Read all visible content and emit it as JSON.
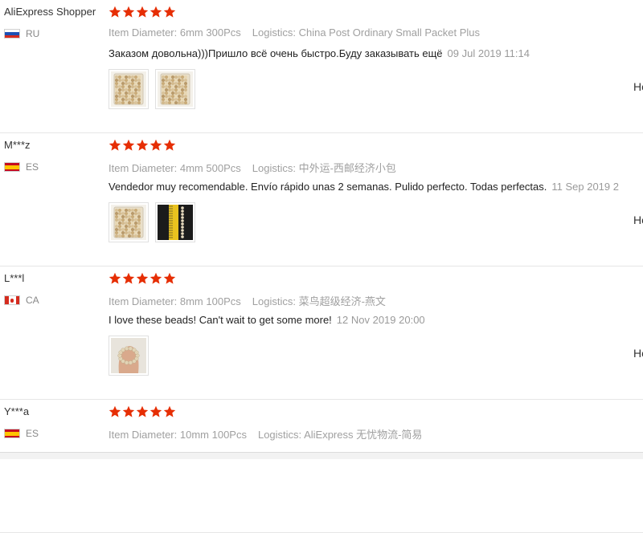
{
  "reviews": [
    {
      "user": "AliExpress Shopper",
      "country_code": "RU",
      "flag": "russia-flag-icon",
      "rating": 5,
      "spec_label": "Item Diameter:",
      "spec_value": "6mm 300Pcs",
      "logistics_label": "Logistics:",
      "logistics_value": "China Post Ordinary Small Packet Plus",
      "text": "Заказом довольна)))Пришло всё очень быстро.Буду заказывать ещё",
      "date": "09 Jul 2019 11:14",
      "photos": [
        "pearl-beads-bag-photo",
        "pearl-beads-bag-photo"
      ],
      "helpful": "He"
    },
    {
      "user": "M***z",
      "country_code": "ES",
      "flag": "spain-flag-icon",
      "rating": 5,
      "spec_label": "Item Diameter:",
      "spec_value": "4mm 500Pcs",
      "logistics_label": "Logistics:",
      "logistics_value": "中外运-西邮经济小包",
      "text": "Vendedor muy recomendable. Envío rápido unas 2 semanas. Pulido perfecto. Todas perfectas.",
      "date": "11 Sep 2019 2",
      "photos": [
        "pearl-beads-bag-photo",
        "beads-on-ruler-photo"
      ],
      "helpful": "He"
    },
    {
      "user": "L***l",
      "country_code": "CA",
      "flag": "canada-flag-icon",
      "rating": 5,
      "spec_label": "Item Diameter:",
      "spec_value": "8mm 100Pcs",
      "logistics_label": "Logistics:",
      "logistics_value": "菜鸟超级经济-燕文",
      "text": "I love these beads! Can't wait to get some more!",
      "date": "12 Nov 2019 20:00",
      "photos": [
        "bead-bracelet-hand-photo"
      ],
      "helpful": "He"
    },
    {
      "user": "Y***a",
      "country_code": "ES",
      "flag": "spain-flag-icon",
      "rating": 5,
      "spec_label": "Item Diameter:",
      "spec_value": "10mm 100Pcs",
      "logistics_label": "Logistics:",
      "logistics_value": "AliExpress 无忧物流-简易",
      "text": "",
      "date": "",
      "photos": [],
      "helpful": ""
    }
  ],
  "colors": {
    "star": "#e62e04",
    "meta_text": "#a0a0a0",
    "date_text": "#9a9a9a"
  }
}
